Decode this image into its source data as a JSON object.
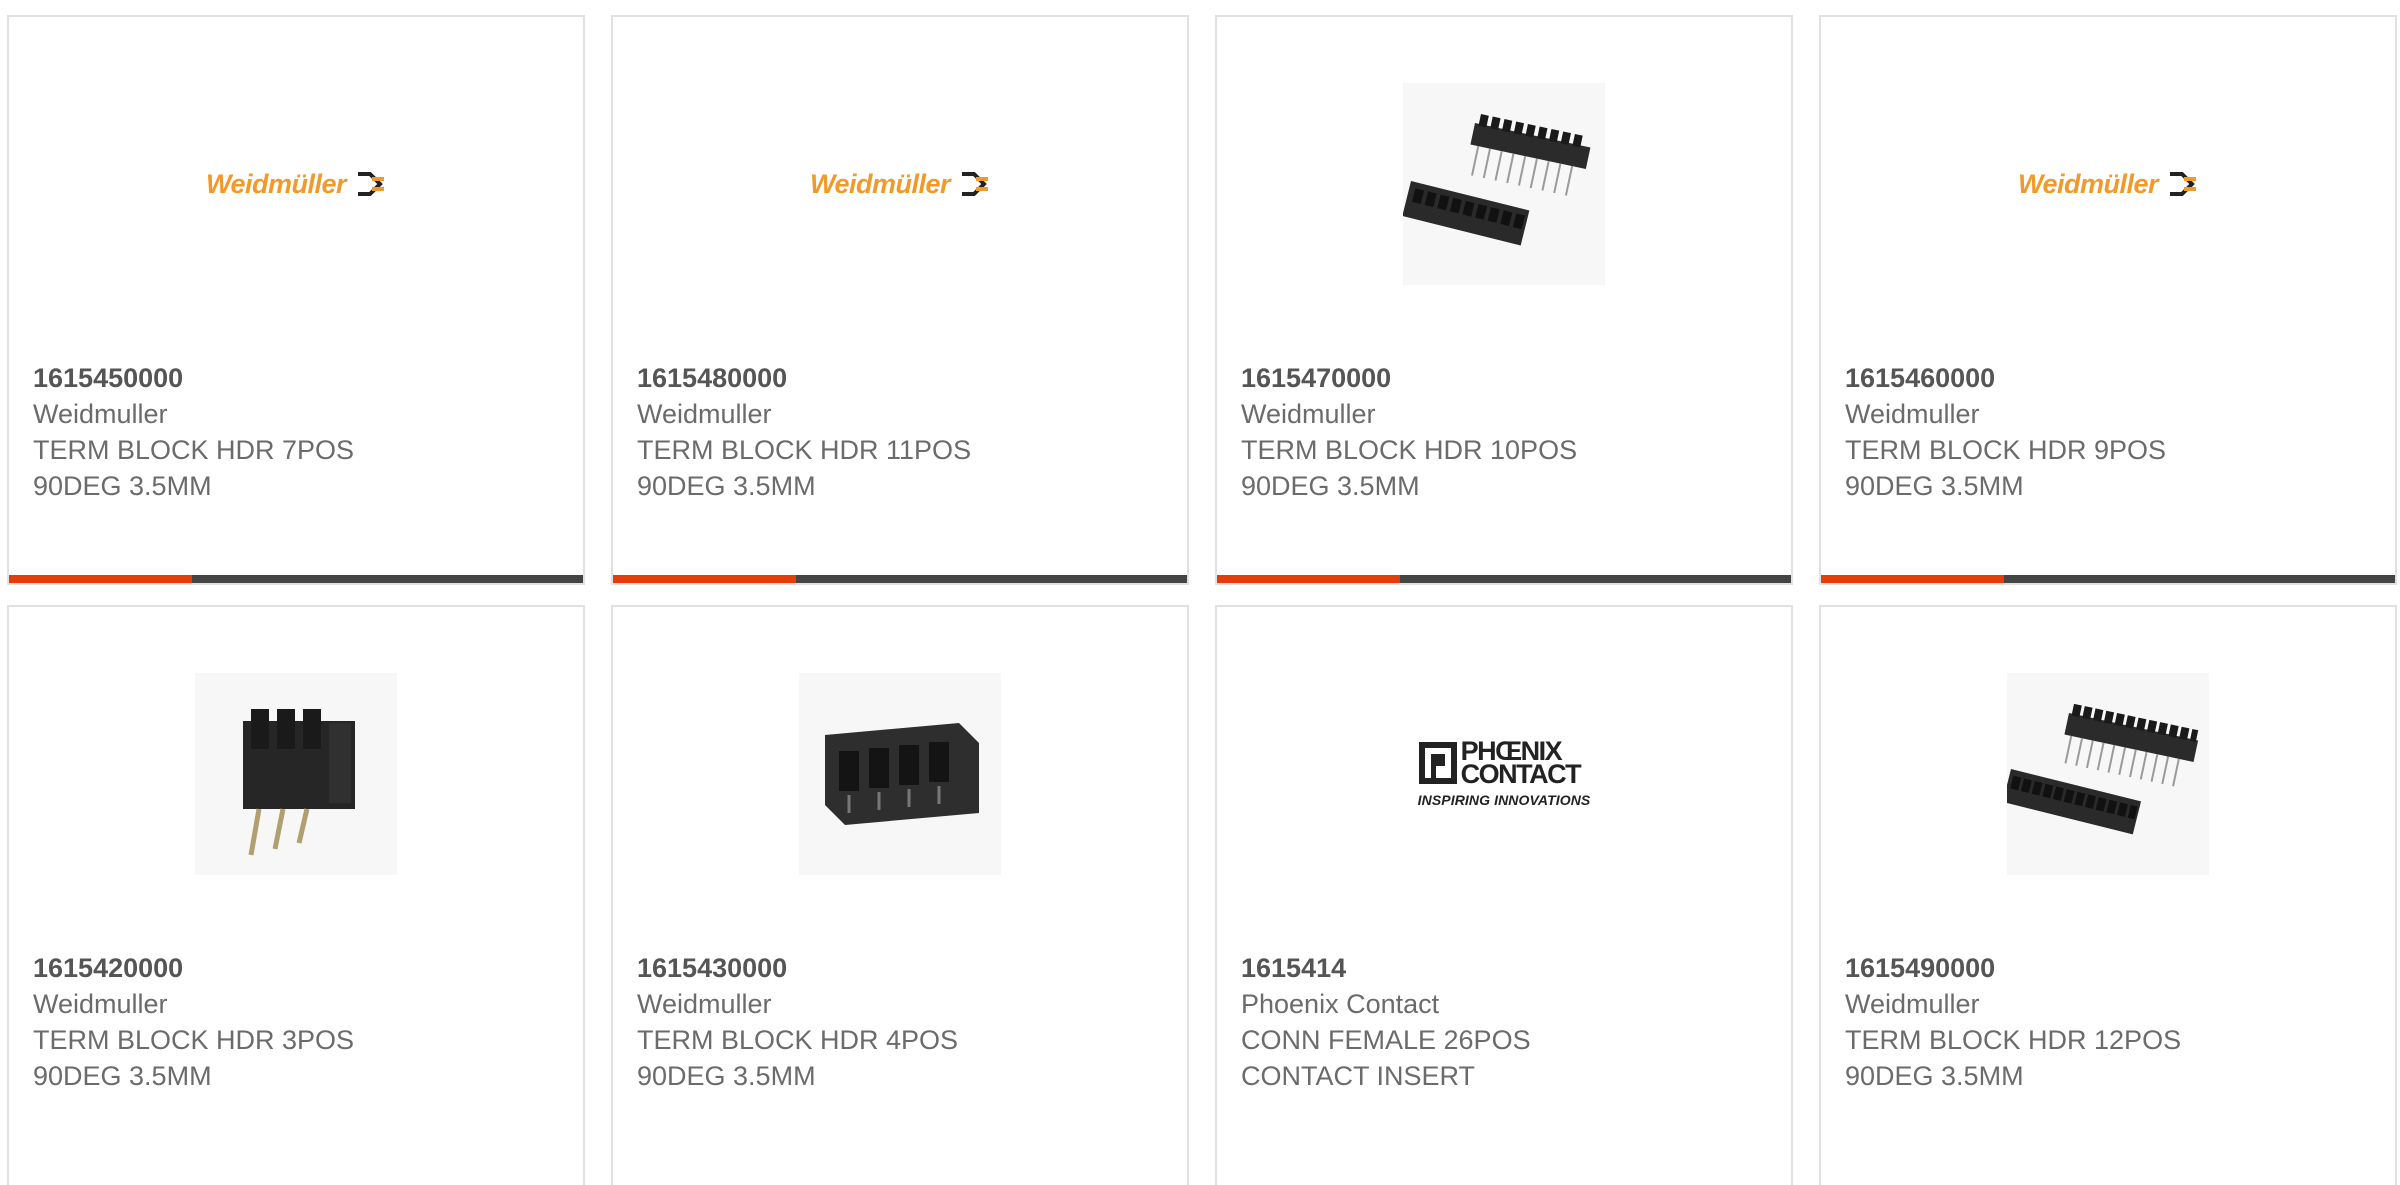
{
  "products": [
    {
      "part_number": "1615450000",
      "manufacturer": "Weidmuller",
      "desc_line1": "TERM BLOCK HDR 7POS",
      "desc_line2": "90DEG 3.5MM",
      "image": "weidmuller-logo",
      "logo_text": "Weidmüller"
    },
    {
      "part_number": "1615480000",
      "manufacturer": "Weidmuller",
      "desc_line1": "TERM BLOCK HDR 11POS",
      "desc_line2": "90DEG 3.5MM",
      "image": "weidmuller-logo",
      "logo_text": "Weidmüller"
    },
    {
      "part_number": "1615470000",
      "manufacturer": "Weidmuller",
      "desc_line1": "TERM BLOCK HDR 10POS",
      "desc_line2": "90DEG 3.5MM",
      "image": "header-pair-photo"
    },
    {
      "part_number": "1615460000",
      "manufacturer": "Weidmuller",
      "desc_line1": "TERM BLOCK HDR 9POS",
      "desc_line2": "90DEG 3.5MM",
      "image": "weidmuller-logo",
      "logo_text": "Weidmüller"
    },
    {
      "part_number": "1615420000",
      "manufacturer": "Weidmuller",
      "desc_line1": "TERM BLOCK HDR 3POS",
      "desc_line2": "90DEG 3.5MM",
      "image": "header-3pos-photo"
    },
    {
      "part_number": "1615430000",
      "manufacturer": "Weidmuller",
      "desc_line1": "TERM BLOCK HDR 4POS",
      "desc_line2": "90DEG 3.5MM",
      "image": "header-4pos-photo"
    },
    {
      "part_number": "1615414",
      "manufacturer": "Phoenix Contact",
      "desc_line1": "CONN FEMALE 26POS",
      "desc_line2": "CONTACT INSERT",
      "image": "phoenix-contact-logo",
      "logo_text_1": "PHŒNIX",
      "logo_text_2": "CONTACT",
      "logo_tagline": "INSPIRING INNOVATIONS"
    },
    {
      "part_number": "1615490000",
      "manufacturer": "Weidmuller",
      "desc_line1": "TERM BLOCK HDR 12POS",
      "desc_line2": "90DEG 3.5MM",
      "image": "header-pair-photo"
    }
  ],
  "colors": {
    "accent_bar": "#e63c0a",
    "bar_dark": "#444444",
    "weidmuller_orange": "#f19a2a",
    "text": "#6b6b6b",
    "border": "#e1e1e1"
  }
}
